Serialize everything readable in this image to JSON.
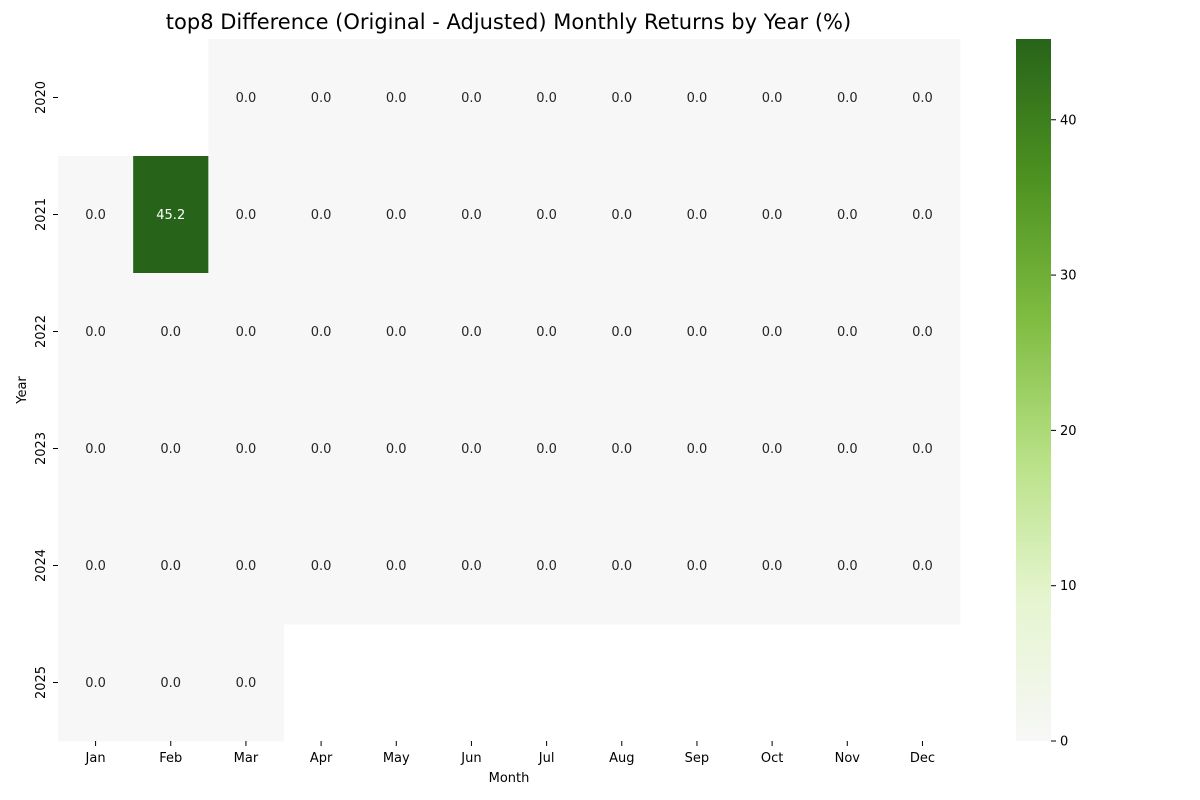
{
  "chart_data": {
    "type": "heatmap",
    "title": "top8 Difference (Original - Adjusted) Monthly Returns by Year (%)",
    "xlabel": "Month",
    "ylabel": "Year",
    "x_categories": [
      "Jan",
      "Feb",
      "Mar",
      "Apr",
      "May",
      "Jun",
      "Jul",
      "Aug",
      "Sep",
      "Oct",
      "Nov",
      "Dec"
    ],
    "y_categories": [
      "2020",
      "2021",
      "2022",
      "2023",
      "2024",
      "2025"
    ],
    "values": [
      [
        null,
        null,
        0.0,
        0.0,
        0.0,
        0.0,
        0.0,
        0.0,
        0.0,
        0.0,
        0.0,
        0.0
      ],
      [
        0.0,
        45.2,
        0.0,
        0.0,
        0.0,
        0.0,
        0.0,
        0.0,
        0.0,
        0.0,
        0.0,
        0.0
      ],
      [
        0.0,
        0.0,
        0.0,
        0.0,
        0.0,
        0.0,
        0.0,
        0.0,
        0.0,
        0.0,
        0.0,
        0.0
      ],
      [
        0.0,
        0.0,
        0.0,
        0.0,
        0.0,
        0.0,
        0.0,
        0.0,
        0.0,
        0.0,
        0.0,
        0.0
      ],
      [
        0.0,
        0.0,
        0.0,
        0.0,
        0.0,
        0.0,
        0.0,
        0.0,
        0.0,
        0.0,
        0.0,
        0.0
      ],
      [
        0.0,
        0.0,
        0.0,
        null,
        null,
        null,
        null,
        null,
        null,
        null,
        null,
        null
      ]
    ],
    "colorbar": {
      "vmin": 0,
      "vmax": 45.2,
      "ticks": [
        0,
        10,
        20,
        30,
        40
      ],
      "colormap": "white-to-dark-green",
      "colors": [
        "#f7f7f7",
        "#e6f5d0",
        "#b8e186",
        "#7fbc41",
        "#4d9221",
        "#276419"
      ]
    },
    "annotations": "values shown in each cell with one decimal",
    "grid": false
  }
}
